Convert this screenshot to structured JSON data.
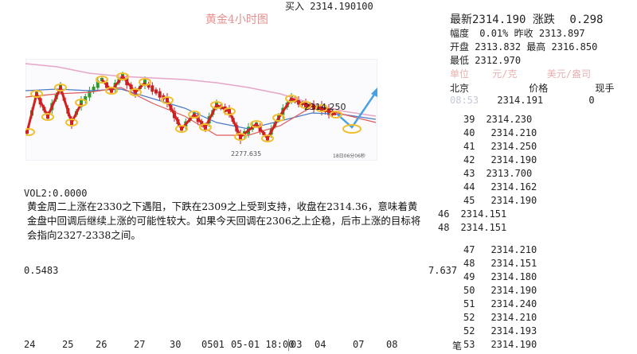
{
  "top": {
    "buy_label": "买入",
    "buy_value": "2314.190100"
  },
  "chart": {
    "title": "黄金4小时图",
    "price_tag": "2314.250",
    "low_tag": "2277.635",
    "time_tag": "18日06分06秒",
    "colors": {
      "ma_red": "#e05a5a",
      "ma_blue": "#4a7ac8",
      "ma_pink": "#e6a6c6",
      "up_green": "#2e9a2e",
      "down_red": "#c82020",
      "circle": "#f0c030",
      "arrow_blue": "#4aa0e0"
    }
  },
  "vol_label": "VOL2:0.0000",
  "analysis": "黄金周二上涨在2330之下遇阻，下跌在2309之上受到支持，收盘在2314.36，意味着黄金盘中回调后继续上涨的可能性较大。如果今天回调在2306之上企稳，后市上涨的目标将会指向2327-2338之间。",
  "left_value": "0.5483",
  "mid_value": "7.637",
  "timeline": [
    "24",
    "25",
    "26",
    "27",
    "30",
    "0501",
    "05-01 18:00",
    "03",
    "04",
    "07",
    "08"
  ],
  "quote": {
    "latest_label": "最新",
    "latest_value": "2314.190",
    "change_label": "涨跌",
    "change_value": "0.298",
    "range_label": "幅度",
    "range_value": "0.01%",
    "prev_close_label": "昨收",
    "prev_close_value": "2313.897",
    "open_label": "开盘",
    "open_value": "2313.832",
    "high_label": "最高",
    "high_value": "2316.850",
    "low_label": "最低",
    "low_value": "2312.970",
    "unit_label": "单位",
    "unit_value": "元/克",
    "unit_value2": "美元/盎司",
    "col_time": "北京",
    "col_price": "价格",
    "col_volume": "现手",
    "first_time": "08:53",
    "first_price": "2314.191",
    "first_volume": "0"
  },
  "trades": [
    {
      "t": "39",
      "p": "2314.230"
    },
    {
      "t": "40",
      "p": "2314.210"
    },
    {
      "t": "41",
      "p": "2314.250"
    },
    {
      "t": "42",
      "p": "2314.190"
    },
    {
      "t": "43",
      "p": "2313.700"
    },
    {
      "t": "44",
      "p": "2314.162"
    },
    {
      "t": "45",
      "p": "2314.190"
    }
  ],
  "side_trades": [
    {
      "t": "46",
      "p": "2314.151"
    },
    {
      "t": "48",
      "p": "2314.151"
    }
  ],
  "trades2": [
    {
      "t": "47",
      "p": "2314.210"
    },
    {
      "t": "48",
      "p": "2314.151"
    },
    {
      "t": "49",
      "p": "2314.180"
    },
    {
      "t": "50",
      "p": "2314.190"
    },
    {
      "t": "51",
      "p": "2314.240"
    },
    {
      "t": "52",
      "p": "2314.210"
    },
    {
      "t": "52",
      "p": "2314.193"
    },
    {
      "t": "53",
      "p": "2314.190"
    }
  ],
  "bottom_right_char": "笔"
}
